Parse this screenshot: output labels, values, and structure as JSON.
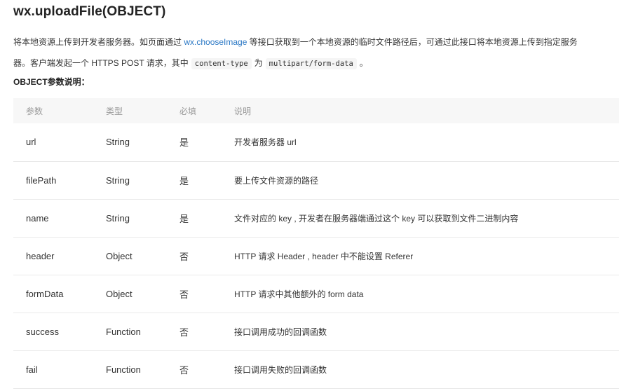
{
  "title": "wx.uploadFile(OBJECT)",
  "description": {
    "text_before_link": "将本地资源上传到开发者服务器。如页面通过 ",
    "link": "wx.chooseImage",
    "text_after_link_line1": " 等接口获取到一个本地资源的临时文件路径后，可通过此接口将本地资源上传到指定服务",
    "text_line2_start": "器。客户端发起一个 HTTPS POST 请求，其中",
    "code_1": "content-type",
    "text_mid": "为",
    "code_2": "multipart/form-data",
    "text_end": "。"
  },
  "subheading": "OBJECT参数说明：",
  "table": {
    "headers": [
      "参数",
      "类型",
      "必填",
      "说明"
    ],
    "rows": [
      {
        "param": "url",
        "type": "String",
        "required": "是",
        "desc": "开发者服务器 url"
      },
      {
        "param": "filePath",
        "type": "String",
        "required": "是",
        "desc": "要上传文件资源的路径"
      },
      {
        "param": "name",
        "type": "String",
        "required": "是",
        "desc": "文件对应的 key , 开发者在服务器端通过这个 key 可以获取到文件二进制内容"
      },
      {
        "param": "header",
        "type": "Object",
        "required": "否",
        "desc": "HTTP 请求 Header , header 中不能设置 Referer"
      },
      {
        "param": "formData",
        "type": "Object",
        "required": "否",
        "desc": "HTTP 请求中其他额外的 form data"
      },
      {
        "param": "success",
        "type": "Function",
        "required": "否",
        "desc": "接口调用成功的回调函数"
      },
      {
        "param": "fail",
        "type": "Function",
        "required": "否",
        "desc": "接口调用失败的回调函数"
      }
    ]
  },
  "colors": {
    "link": "#2b78c5",
    "header_bg": "#f7f7f7",
    "divider": "#e9e9e9"
  }
}
